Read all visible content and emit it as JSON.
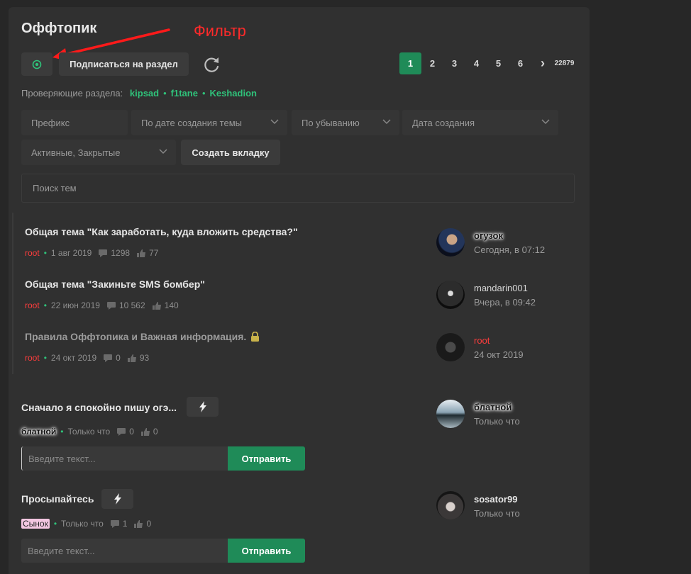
{
  "header": {
    "title": "Оффтопик",
    "annotation_label": "Фильтр"
  },
  "toolbar": {
    "subscribe_label": "Подписаться на раздел"
  },
  "pagination": {
    "pages": [
      "1",
      "2",
      "3",
      "4",
      "5",
      "6"
    ],
    "next": "›",
    "last": "22879",
    "current": "1"
  },
  "reviewers": {
    "label": "Проверяющие раздела:",
    "names": [
      "kipsad",
      "f1tane",
      "Keshadion"
    ]
  },
  "filters": {
    "prefix": "Префикс",
    "sort_by": "По дате создания темы",
    "order": "По убыванию",
    "date": "Дата создания",
    "state": "Активные, Закрытые",
    "create_tab": "Создать вкладку",
    "search_placeholder": "Поиск тем"
  },
  "sticky_threads": [
    {
      "title": "Общая тема \"Как заработать, куда вложить средства?\"",
      "author": "root",
      "date": "1 авг 2019",
      "replies": "1298",
      "likes": "77",
      "last_user": "огузок",
      "last_time": "Сегодня, в 07:12"
    },
    {
      "title": "Общая тема \"Закиньте SMS бомбер\"",
      "author": "root",
      "date": "22 июн 2019",
      "replies": "10 562",
      "likes": "140",
      "last_user": "mandarin001",
      "last_time": "Вчера, в 09:42"
    },
    {
      "title": "Правила Оффтопика и Важная информация.",
      "author": "root",
      "date": "24 окт 2019",
      "replies": "0",
      "likes": "93",
      "last_user": "root",
      "last_time": "24 окт 2019"
    }
  ],
  "threads": [
    {
      "title": "Сначало я спокойно пишу огэ...",
      "author": "блатной",
      "date": "Только что",
      "replies": "0",
      "likes": "0",
      "last_user": "блатной",
      "last_time": "Только что",
      "reply_placeholder": "Введите текст...",
      "send": "Отправить"
    },
    {
      "title": "Просыпайтесь",
      "author": "Сынок",
      "date": "Только что",
      "replies": "1",
      "likes": "0",
      "last_user": "sosator99",
      "last_time": "Только что",
      "reply_placeholder": "Введите текст...",
      "send": "Отправить"
    }
  ],
  "colors": {
    "accent": "#1f8b58",
    "link": "#2fc27a",
    "author_red": "#ff3d3d",
    "annotation": "#ff2a2a"
  }
}
